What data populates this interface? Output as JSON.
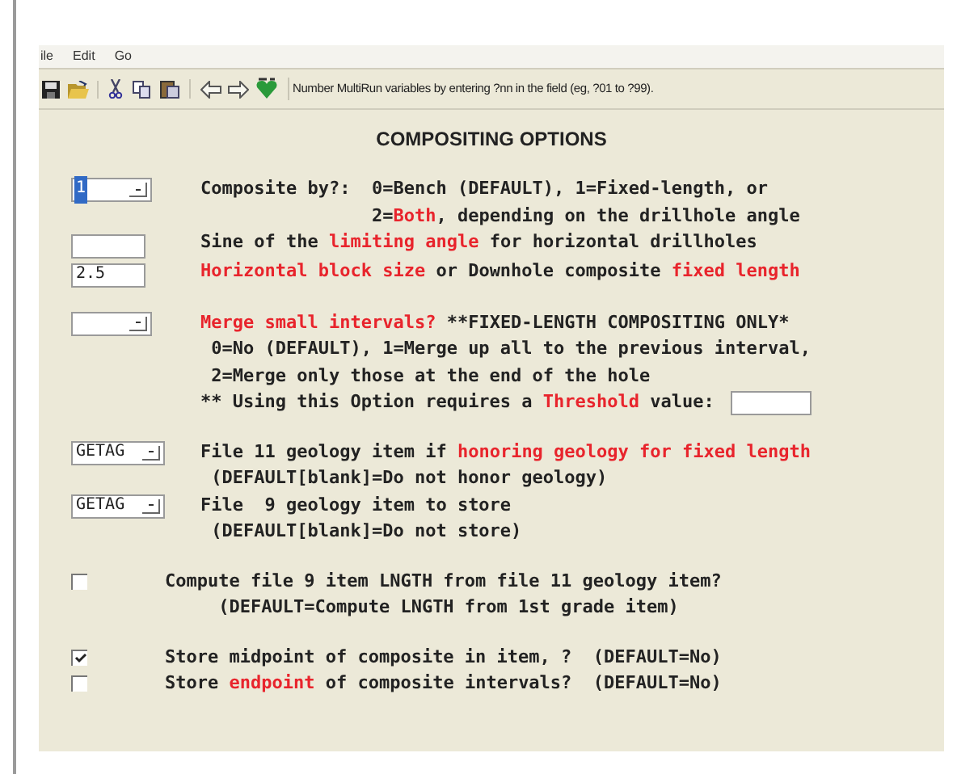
{
  "menu": [
    "ile",
    "Edit",
    "Go"
  ],
  "toolbar": {
    "hint": "Number MultiRun variables by entering ?nn in the field (eg, ?01 to ?99)."
  },
  "title": "COMPOSITING OPTIONS",
  "groups": [
    [
      {
        "kind": "dropdown",
        "value": "1",
        "value_selected": true,
        "lines": [
          {
            "segments": [
              {
                "text": "Composite by?:  0=Bench (DEFAULT), 1=Fixed-length, or",
                "red": false
              }
            ]
          },
          {
            "segments": [
              {
                "text": "                2=",
                "red": false
              },
              {
                "text": "Both",
                "red": true
              },
              {
                "text": ", depending on the drillhole angle",
                "red": false
              }
            ]
          }
        ]
      },
      {
        "kind": "text",
        "lines": [
          {
            "segments": [
              {
                "text": "Sine of the ",
                "red": false
              },
              {
                "text": "limiting angle",
                "red": true
              },
              {
                "text": " for horizontal drillholes",
                "red": false
              }
            ]
          }
        ]
      },
      {
        "kind": "text",
        "value": "2.5",
        "lines": [
          {
            "segments": [
              {
                "text": "Horizontal block size",
                "red": true
              },
              {
                "text": " or Downhole composite ",
                "red": false
              },
              {
                "text": "fixed length",
                "red": true
              }
            ]
          }
        ]
      }
    ],
    [
      {
        "kind": "dropdown",
        "lines": [
          {
            "segments": [
              {
                "text": "Merge small intervals?",
                "red": true
              },
              {
                "text": " **FIXED-LENGTH COMPOSITING ONLY*",
                "red": false
              }
            ]
          },
          {
            "segments": [
              {
                "text": " 0=No (DEFAULT), 1=Merge up all to the previous interval,",
                "red": false
              }
            ]
          },
          {
            "segments": [
              {
                "text": " 2=Merge only those at the end of the hole",
                "red": false
              }
            ]
          },
          {
            "segments": [
              {
                "text": "** Using this Option requires a ",
                "red": false
              },
              {
                "text": "Threshold",
                "red": true
              },
              {
                "text": " value:",
                "red": false
              }
            ],
            "has_field": true
          }
        ]
      }
    ],
    [
      {
        "kind": "dropdown",
        "value": "GETAG",
        "value_selected": false,
        "lines": [
          {
            "segments": [
              {
                "text": "File 11 geology item if ",
                "red": false
              },
              {
                "text": "honoring geology for fixed length",
                "red": true
              }
            ]
          },
          {
            "segments": [
              {
                "text": " (DEFAULT[blank]=Do not honor geology)",
                "red": false
              }
            ]
          }
        ]
      },
      {
        "kind": "dropdown",
        "value": "GETAG",
        "value_selected": false,
        "lines": [
          {
            "segments": [
              {
                "text": "File  9 geology item to store",
                "red": false
              }
            ]
          },
          {
            "segments": [
              {
                "text": " (DEFAULT[blank]=Do not store)",
                "red": false
              }
            ]
          }
        ]
      }
    ],
    [
      {
        "kind": "checkbox",
        "checked": false,
        "lines": [
          {
            "segments": [
              {
                "text": "Compute file 9 item LNGTH from file 11 geology item?",
                "red": false
              }
            ]
          },
          {
            "segments": [
              {
                "text": "     (DEFAULT=Compute LNGTH from 1st grade item)",
                "red": false
              }
            ]
          }
        ]
      }
    ],
    [
      {
        "kind": "checkbox",
        "checked": true,
        "lines": [
          {
            "segments": [
              {
                "text": "Store midpoint of composite in item, ?  (DEFAULT=No)",
                "red": false
              }
            ]
          }
        ]
      },
      {
        "kind": "checkbox",
        "checked": false,
        "lines": [
          {
            "segments": [
              {
                "text": "Store ",
                "red": false
              },
              {
                "text": "endpoint",
                "red": true
              },
              {
                "text": " of composite intervals?  (DEFAULT=No)",
                "red": false
              }
            ]
          }
        ]
      }
    ]
  ]
}
